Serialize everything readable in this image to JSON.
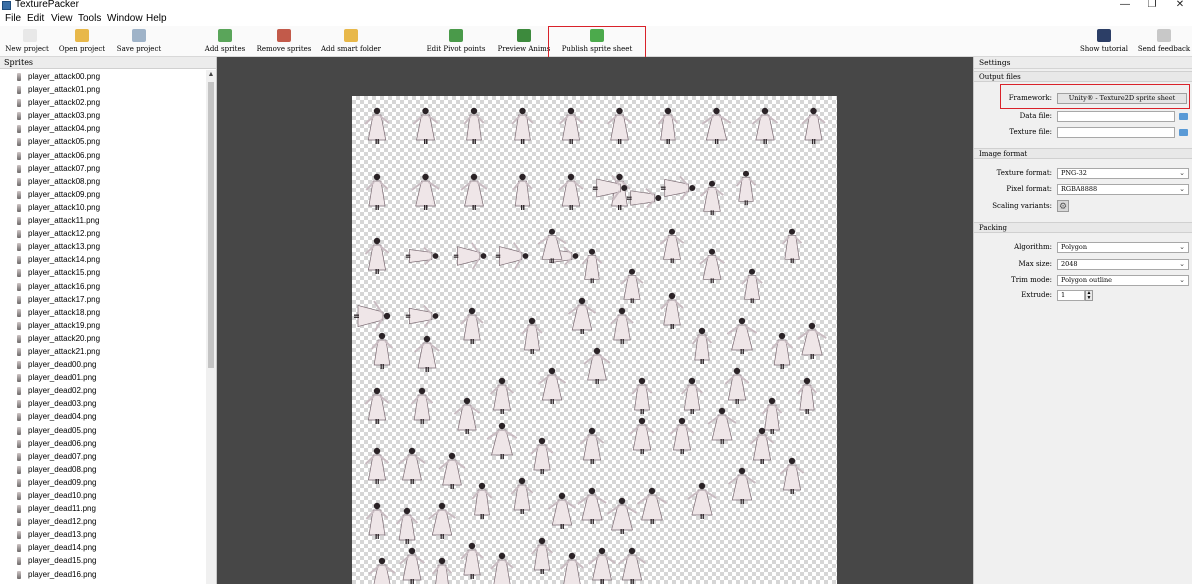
{
  "window": {
    "title": "TexturePacker",
    "minimize": "—",
    "maximize": "❐",
    "close": "✕"
  },
  "menu": [
    "File",
    "Edit",
    "View",
    "Tools",
    "Window",
    "Help"
  ],
  "toolbar": {
    "items": [
      {
        "label": "New project",
        "icon": "new-file-icon",
        "color": "#e8e8e8"
      },
      {
        "label": "Open project",
        "icon": "folder-icon",
        "color": "#e8b84a"
      },
      {
        "label": "Save project",
        "icon": "save-icon",
        "color": "#9fb3c8"
      },
      {
        "label": "Add sprites",
        "icon": "add-sprites-icon",
        "color": "#5aa55a"
      },
      {
        "label": "Remove sprites",
        "icon": "remove-sprites-icon",
        "color": "#c25a4a"
      },
      {
        "label": "Add smart folder",
        "icon": "smart-folder-icon",
        "color": "#e8b84a"
      },
      {
        "label": "Edit Pivot points",
        "icon": "pivot-icon",
        "color": "#4a9a4a"
      },
      {
        "label": "Preview Anims",
        "icon": "anim-preview-icon",
        "color": "#3d8a3d"
      },
      {
        "label": "Publish sprite sheet",
        "icon": "publish-icon",
        "color": "#4caa4c"
      },
      {
        "label": "Show tutorial",
        "icon": "graduation-cap-icon",
        "color": "#2c3e66"
      },
      {
        "label": "Send feedback",
        "icon": "feedback-icon",
        "color": "#c8c8c8"
      }
    ]
  },
  "sprites": {
    "header": "Sprites",
    "items": [
      "player_attack00.png",
      "player_attack01.png",
      "player_attack02.png",
      "player_attack03.png",
      "player_attack04.png",
      "player_attack05.png",
      "player_attack06.png",
      "player_attack07.png",
      "player_attack08.png",
      "player_attack09.png",
      "player_attack10.png",
      "player_attack11.png",
      "player_attack12.png",
      "player_attack13.png",
      "player_attack14.png",
      "player_attack15.png",
      "player_attack16.png",
      "player_attack17.png",
      "player_attack18.png",
      "player_attack19.png",
      "player_attack20.png",
      "player_attack21.png",
      "player_dead00.png",
      "player_dead01.png",
      "player_dead02.png",
      "player_dead03.png",
      "player_dead04.png",
      "player_dead05.png",
      "player_dead06.png",
      "player_dead07.png",
      "player_dead08.png",
      "player_dead09.png",
      "player_dead10.png",
      "player_dead11.png",
      "player_dead12.png",
      "player_dead13.png",
      "player_dead14.png",
      "player_dead15.png",
      "player_dead16.png"
    ]
  },
  "settings": {
    "header": "Settings",
    "output_files": {
      "title": "Output files",
      "framework_label": "Framework:",
      "framework_value": "Unity® - Texture2D sprite sheet",
      "data_file_label": "Data file:",
      "data_file_value": "",
      "texture_file_label": "Texture file:",
      "texture_file_value": ""
    },
    "image_format": {
      "title": "Image format",
      "texture_format_label": "Texture format:",
      "texture_format_value": "PNG-32",
      "pixel_format_label": "Pixel format:",
      "pixel_format_value": "RGBA8888",
      "scaling_variants_label": "Scaling variants:"
    },
    "packing": {
      "title": "Packing",
      "algorithm_label": "Algorithm:",
      "algorithm_value": "Polygon",
      "max_size_label": "Max size:",
      "max_size_value": "2048",
      "trim_mode_label": "Trim mode:",
      "trim_mode_value": "Polygon outline",
      "extrude_label": "Extrude:",
      "extrude_value": "1"
    }
  },
  "colors": {
    "highlight": "#d9222a",
    "canvas_bg": "#474747"
  }
}
